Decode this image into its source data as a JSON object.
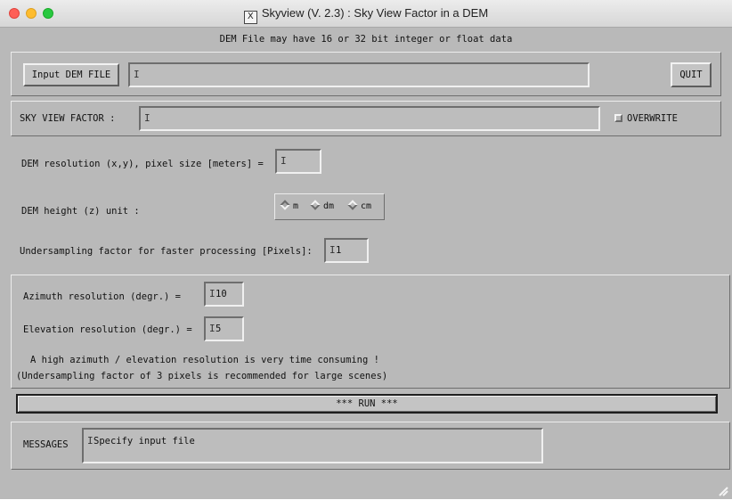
{
  "window": {
    "title": "Skyview (V. 2.3) : Sky View Factor in a DEM",
    "controls": {
      "close_color": "#fe5f57",
      "minimize_color": "#febc2e",
      "zoom_color": "#28c840"
    }
  },
  "header_note": "DEM File may have 16 or 32 bit integer or float data",
  "input_dem": {
    "button_label": "Input DEM FILE",
    "value": ""
  },
  "quit_label": "QUIT",
  "svf": {
    "label": "SKY VIEW FACTOR  :",
    "value": "",
    "overwrite_label": "OVERWRITE",
    "overwrite_checked": false
  },
  "resolution": {
    "label": "DEM resolution (x,y), pixel size [meters]  =",
    "value": ""
  },
  "height_unit": {
    "label": "DEM height (z) unit :",
    "options": [
      "m",
      "dm",
      "cm"
    ],
    "selected": "m"
  },
  "undersampling": {
    "label": "Undersampling factor for faster processing [Pixels]:",
    "value": "1"
  },
  "azimuth": {
    "label": "Azimuth   resolution (degr.) =",
    "value": "10"
  },
  "elevation": {
    "label": "Elevation resolution (degr.) =",
    "value": "5"
  },
  "notes": {
    "line1": "A high azimuth / elevation resolution is very time consuming !",
    "line2": "(Undersampling factor of 3 pixels is recommended for large scenes)"
  },
  "run_label": "*** RUN ***",
  "messages": {
    "label": "MESSAGES",
    "text": "Specify input file"
  }
}
